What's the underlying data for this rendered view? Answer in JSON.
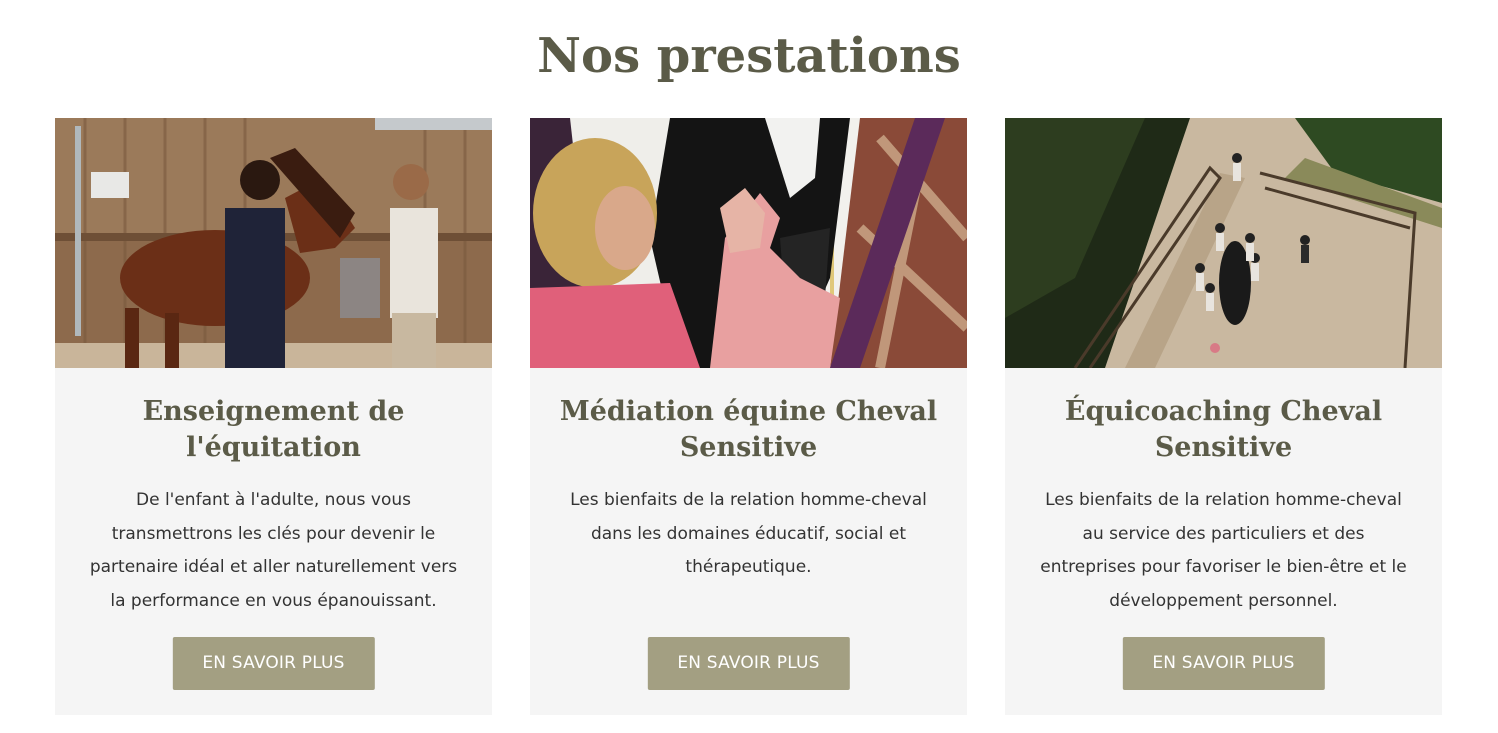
{
  "section": {
    "title": "Nos prestations"
  },
  "cards": [
    {
      "title": "Enseignement de l'équitation",
      "description": "De l'enfant à l'adulte, nous vous transmettrons les clés pour devenir le partenaire idéal et aller naturellement vers la performance en vous épanouissant.",
      "button_label": "EN SAVOIR PLUS",
      "image": "photo-riding-lesson"
    },
    {
      "title": "Médiation équine Cheval Sensitive",
      "description": "Les bienfaits de la relation homme-cheval dans les domaines éducatif, social et thérapeutique.",
      "button_label": "EN SAVOIR PLUS",
      "image": "photo-equine-mediation"
    },
    {
      "title": "Équicoaching Cheval Sensitive",
      "description": "Les bienfaits de la relation homme-cheval au service des particuliers et des entreprises pour favoriser le bien-être et le développement personnel.",
      "button_label": "EN SAVOIR PLUS",
      "image": "photo-equicoaching-aerial"
    }
  ],
  "colors": {
    "heading": "#5b5b48",
    "card_background": "#f5f5f5",
    "button": "#a39f82",
    "button_text": "#ffffff",
    "body_text": "#333333"
  }
}
